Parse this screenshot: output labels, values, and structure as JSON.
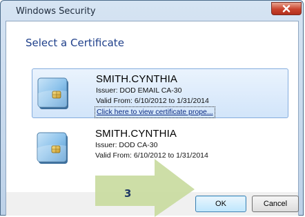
{
  "window": {
    "title": "Windows Security",
    "heading": "Select a Certificate"
  },
  "certificates": [
    {
      "name": "SMITH.CYNTHIA",
      "issuer": "Issuer: DOD EMAIL CA-30",
      "valid": "Valid From: 6/10/2012 to 1/31/2014",
      "link": "Click here to view certificate prope...",
      "selected": true
    },
    {
      "name": "SMITH.CYNTHIA",
      "issuer": "Issuer: DOD CA-30",
      "valid": "Valid From: 6/10/2012 to 1/31/2014",
      "selected": false
    }
  ],
  "buttons": {
    "ok": "OK",
    "cancel": "Cancel"
  },
  "callout": {
    "step": "3",
    "color": "#c9dba0"
  },
  "icons": {
    "close": "close-icon",
    "certificate": "smart-card-icon"
  }
}
